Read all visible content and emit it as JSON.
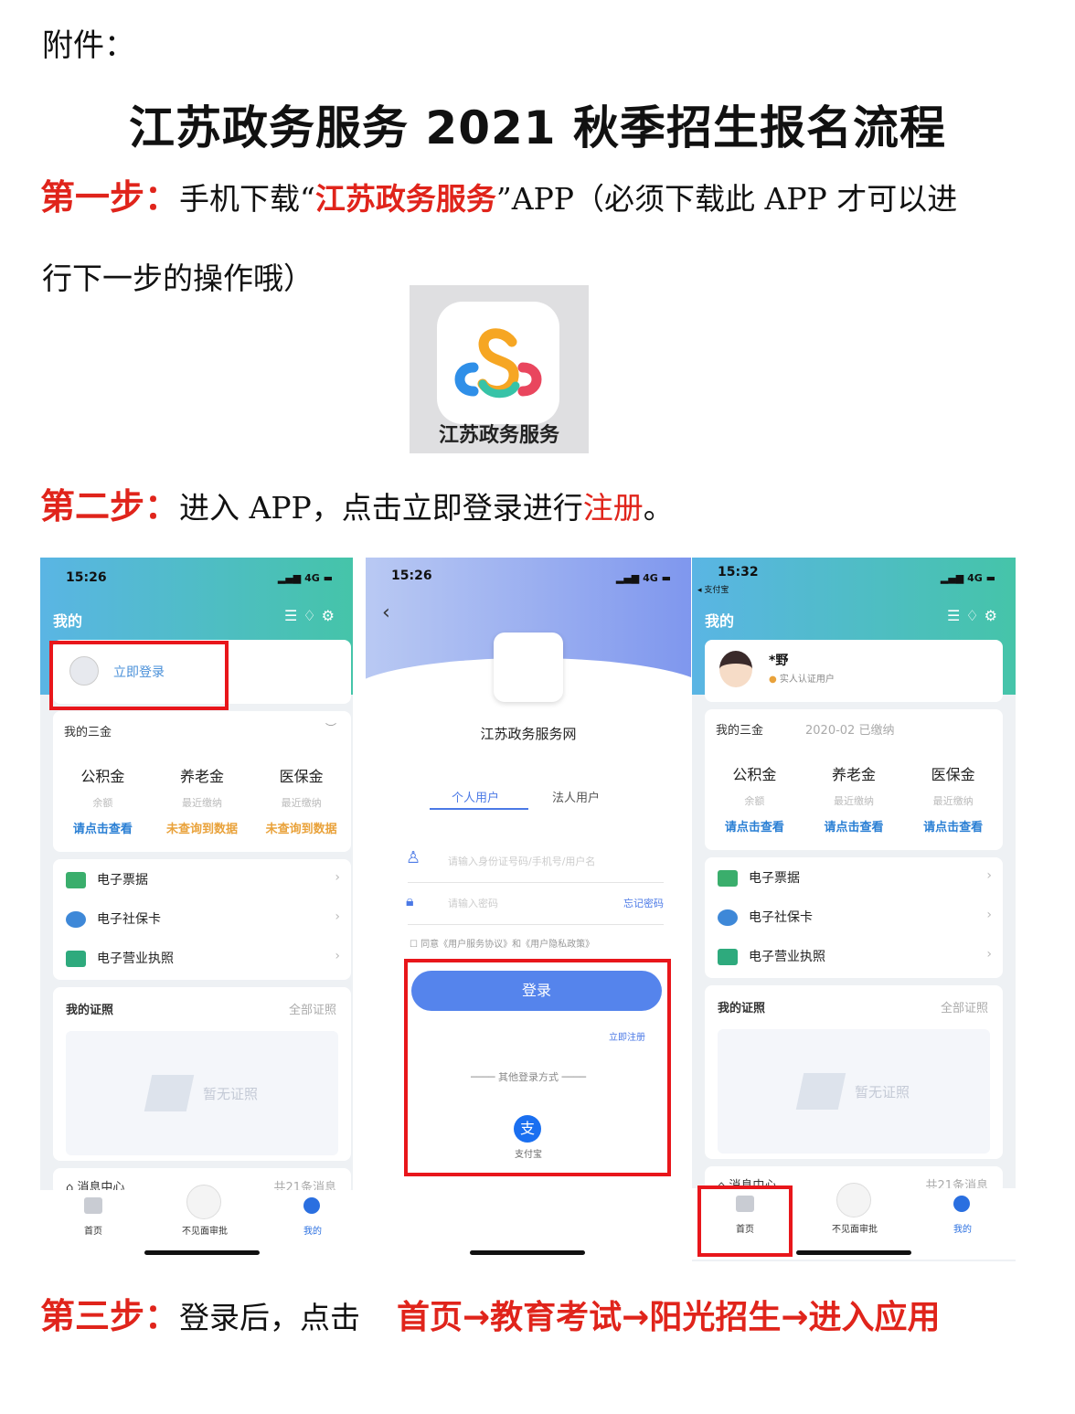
{
  "attachment_label": "附件：",
  "title": "江苏政务服务 2021 秋季招生报名流程",
  "step1": {
    "label": "第一步：",
    "text_a": "手机下载“",
    "app_name": "江苏政务服务",
    "text_b": "”APP（必须下载此 APP 才可以进",
    "text_c": "行下一步的操作哦）"
  },
  "app_icon": {
    "caption": "江苏政务服务",
    "colors": [
      "#f6a623",
      "#2f8fe8",
      "#e9465e",
      "#37c3a7"
    ]
  },
  "step2": {
    "label": "第二步：",
    "text_a": "进入 APP，点击立即登录进行",
    "highlight": "注册",
    "text_b": "。"
  },
  "phone1": {
    "time": "15:26",
    "signal": "4G",
    "title": "我的",
    "login": "立即登录",
    "funds_title": "我的三金",
    "funds": [
      {
        "name": "公积金",
        "sub": "余额",
        "link": "请点击查看"
      },
      {
        "name": "养老金",
        "sub": "最近缴纳",
        "link": "未查询到数据"
      },
      {
        "name": "医保金",
        "sub": "最近缴纳",
        "link": "未查询到数据"
      }
    ],
    "services": [
      "电子票据",
      "电子社保卡",
      "电子营业执照"
    ],
    "certs_title": "我的证照",
    "certs_all": "全部证照",
    "certs_empty": "暂无证照",
    "msg_title": "消息中心",
    "msg_count": "共21条消息",
    "tabs": [
      "首页",
      "不见面审批",
      "我的"
    ]
  },
  "phone2": {
    "time": "15:26",
    "signal": "4G",
    "site_name": "江苏政务服务网",
    "tab_personal": "个人用户",
    "tab_legal": "法人用户",
    "id_placeholder": "请输入身份证号码/手机号/用户名",
    "pwd_placeholder": "请输入密码",
    "forgot": "忘记密码",
    "agree": "同意《用户服务协议》和《用户隐私政策》",
    "login_button": "登录",
    "register": "立即注册",
    "other_login": "其他登录方式",
    "alipay": "支付宝"
  },
  "phone3": {
    "time": "15:32",
    "back_app": "◂ 支付宝",
    "signal": "4G",
    "title": "我的",
    "user_name": "*野",
    "verified": "实人认证用户",
    "funds_title": "我的三金",
    "funds_status": "2020-02 已缴纳",
    "funds": [
      {
        "name": "公积金",
        "sub": "余额",
        "link": "请点击查看"
      },
      {
        "name": "养老金",
        "sub": "最近缴纳",
        "link": "请点击查看"
      },
      {
        "name": "医保金",
        "sub": "最近缴纳",
        "link": "请点击查看"
      }
    ],
    "services": [
      "电子票据",
      "电子社保卡",
      "电子营业执照"
    ],
    "certs_title": "我的证照",
    "certs_all": "全部证照",
    "certs_empty": "暂无证照",
    "msg_title": "消息中心",
    "msg_count": "共21条消息",
    "tabs": [
      "首页",
      "不见面审批",
      "我的"
    ]
  },
  "step3": {
    "label": "第三步：",
    "text_a": "登录后，点击",
    "path": "首页→教育考试→阳光招生→进入应用"
  }
}
